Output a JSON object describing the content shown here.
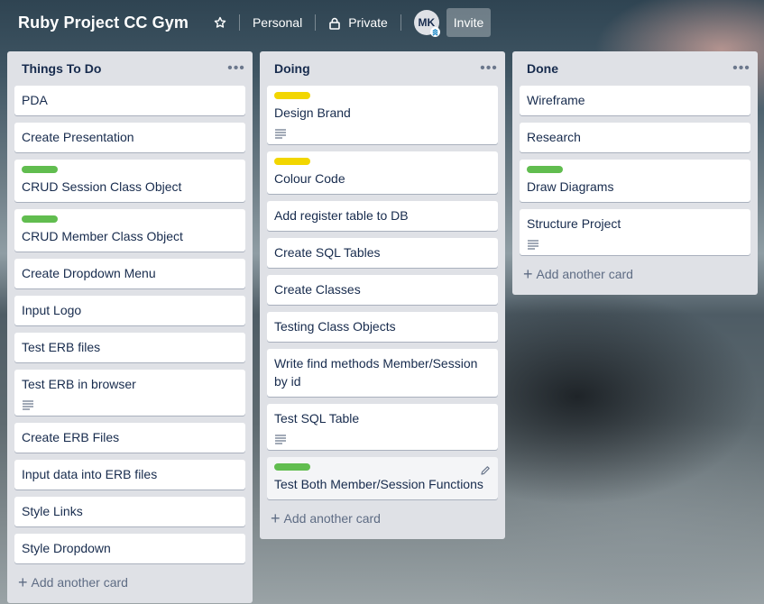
{
  "board": {
    "title": "Ruby Project CC Gym",
    "visibility": "Personal",
    "privacy": "Private",
    "avatar_initials": "MK",
    "invite_label": "Invite"
  },
  "colors": {
    "label_green": "#61bd4f",
    "label_yellow": "#f2d600"
  },
  "add_card_label": "Add another card",
  "lists": [
    {
      "title": "Things To Do",
      "cards": [
        {
          "text": "PDA"
        },
        {
          "text": "Create Presentation"
        },
        {
          "text": "CRUD Session Class Object",
          "label": "green"
        },
        {
          "text": "CRUD Member Class Object",
          "label": "green"
        },
        {
          "text": "Create Dropdown Menu"
        },
        {
          "text": "Input Logo"
        },
        {
          "text": "Test ERB files"
        },
        {
          "text": "Test ERB in browser",
          "description": true
        },
        {
          "text": "Create ERB Files"
        },
        {
          "text": "Input data into ERB files"
        },
        {
          "text": "Style Links"
        },
        {
          "text": "Style Dropdown"
        }
      ]
    },
    {
      "title": "Doing",
      "cards": [
        {
          "text": "Design Brand",
          "label": "yellow",
          "description": true
        },
        {
          "text": "Colour Code",
          "label": "yellow"
        },
        {
          "text": "Add register table to DB"
        },
        {
          "text": "Create SQL Tables"
        },
        {
          "text": "Create Classes"
        },
        {
          "text": "Testing Class Objects"
        },
        {
          "text": "Write find methods Member/Session by id"
        },
        {
          "text": "Test SQL Table",
          "description": true
        },
        {
          "text": "Test Both Member/Session Functions",
          "label": "green",
          "hovered": true
        }
      ]
    },
    {
      "title": "Done",
      "cards": [
        {
          "text": "Wireframe"
        },
        {
          "text": "Research"
        },
        {
          "text": "Draw Diagrams",
          "label": "green"
        },
        {
          "text": "Structure Project",
          "description": true
        }
      ]
    }
  ]
}
